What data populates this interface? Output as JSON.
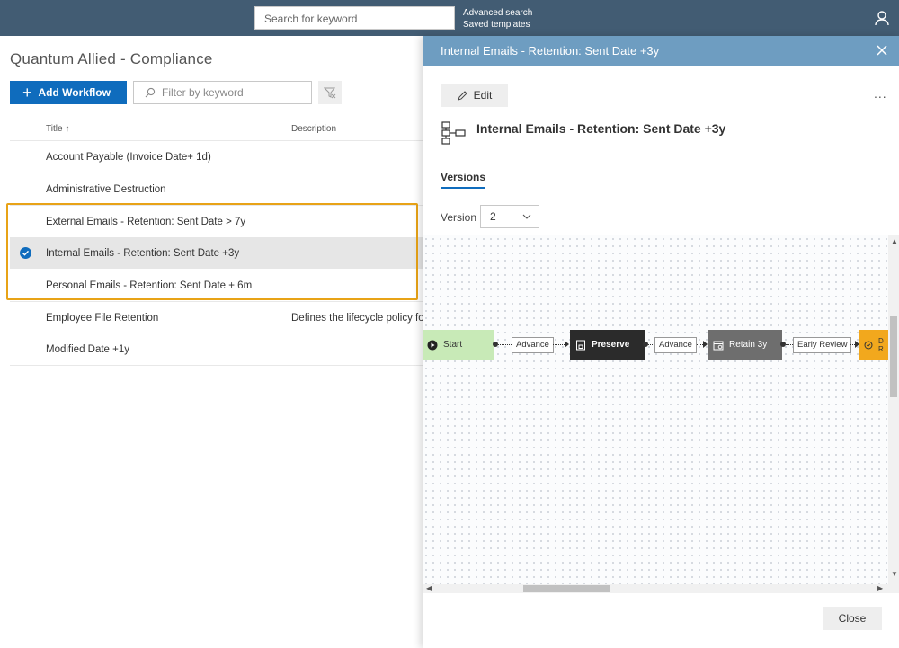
{
  "topbar": {
    "search_placeholder": "Search for keyword",
    "advanced_search": "Advanced search",
    "saved_templates": "Saved templates",
    "user_icon": "user-icon"
  },
  "main": {
    "page_title": "Quantum Allied - Compliance",
    "add_workflow_label": "Add Workflow",
    "filter_placeholder": "Filter by keyword",
    "columns": {
      "title": "Title",
      "title_sort": "↑",
      "description": "Description"
    },
    "rows": [
      {
        "title": "Account Payable (Invoice Date+ 1d)",
        "description": "",
        "selected": false
      },
      {
        "title": "Administrative Destruction",
        "description": "",
        "selected": false
      },
      {
        "title": "External Emails - Retention: Sent Date > 7y",
        "description": "",
        "selected": false
      },
      {
        "title": "Internal Emails - Retention: Sent Date +3y",
        "description": "",
        "selected": true
      },
      {
        "title": "Personal Emails - Retention: Sent Date + 6m",
        "description": "",
        "selected": false
      },
      {
        "title": "Employee File Retention",
        "description": "Defines the lifecycle policy fo",
        "selected": false
      },
      {
        "title": "Modified Date +1y",
        "description": "",
        "selected": false
      }
    ],
    "highlight_color": "#e8a317"
  },
  "panel": {
    "header_title": "Internal Emails - Retention: Sent Date +3y",
    "edit_label": "Edit",
    "more_label": "...",
    "workflow_title": "Internal Emails - Retention: Sent Date +3y",
    "tab_versions": "Versions",
    "version_label": "Version",
    "version_value": "2",
    "close_label": "Close",
    "header_color": "#6e9dc1",
    "workflow": {
      "start": "Start",
      "advance_1": "Advance",
      "preserve": "Preserve",
      "advance_2": "Advance",
      "retain": "Retain 3y",
      "early_review": "Early Review",
      "next_node_partial": "D R"
    }
  },
  "colors": {
    "primary": "#0f6cbd",
    "topbar": "#425c73",
    "start_node": "#c8eab7",
    "orange_node": "#f2a81d"
  }
}
